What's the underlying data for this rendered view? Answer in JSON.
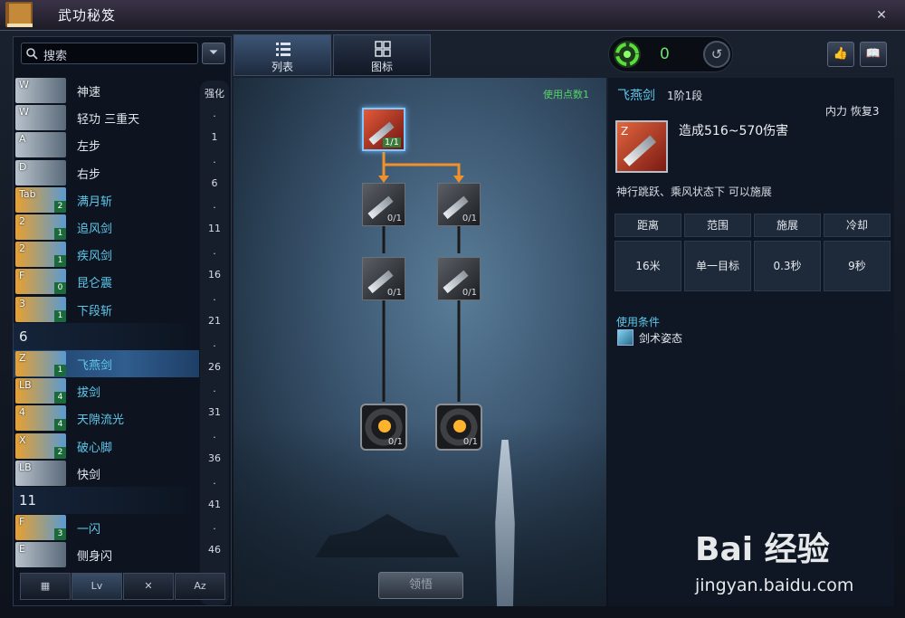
{
  "window": {
    "title": "武功秘笈",
    "close_label": "✕"
  },
  "search": {
    "placeholder": "搜索",
    "filter_icon": "funnel-icon"
  },
  "skill_list": [
    {
      "key": "W",
      "name": "神速",
      "level": "",
      "color": "white"
    },
    {
      "key": "W",
      "name": "轻功 三重天",
      "level": "",
      "color": "white"
    },
    {
      "key": "A",
      "name": "左步",
      "level": "",
      "color": "white"
    },
    {
      "key": "D",
      "name": "右步",
      "level": "",
      "color": "white"
    },
    {
      "key": "Tab",
      "name": "满月斩",
      "level": "2",
      "color": "blue"
    },
    {
      "key": "2",
      "name": "追风剑",
      "level": "1",
      "color": "blue"
    },
    {
      "key": "2",
      "name": "疾风剑",
      "level": "1",
      "color": "blue"
    },
    {
      "key": "F",
      "name": "昆仑震",
      "level": "0",
      "color": "blue"
    },
    {
      "key": "3",
      "name": "下段斩",
      "level": "1",
      "color": "blue"
    },
    {
      "header": "6"
    },
    {
      "key": "Z",
      "name": "飞燕剑",
      "level": "1",
      "color": "blue",
      "selected": true
    },
    {
      "key": "LB",
      "name": "拔剑",
      "level": "4",
      "color": "blue"
    },
    {
      "key": "4",
      "name": "天隙流光",
      "level": "4",
      "color": "blue"
    },
    {
      "key": "X",
      "name": "破心脚",
      "level": "2",
      "color": "blue"
    },
    {
      "key": "LB",
      "name": "快剑",
      "level": "",
      "color": "white"
    },
    {
      "header": "11"
    },
    {
      "key": "F",
      "name": "一闪",
      "level": "3",
      "color": "blue"
    },
    {
      "key": "E",
      "name": "侧身闪",
      "level": "",
      "color": "white"
    }
  ],
  "level_scale": {
    "title": "强化",
    "ticks": [
      "1",
      "6",
      "11",
      "16",
      "21",
      "26",
      "31",
      "36",
      "41",
      "46"
    ]
  },
  "left_tabs": [
    "▦",
    "Lv",
    "✕",
    "Az"
  ],
  "view_tabs": [
    {
      "label": "列表",
      "icon": "list-icon"
    },
    {
      "label": "图标",
      "icon": "grid-icon"
    }
  ],
  "points": {
    "value": "0",
    "icon": "green-swirl-icon",
    "reset_icon": "reset-icon"
  },
  "top_buttons": [
    "👍",
    "📖"
  ],
  "tree": {
    "use_points": "使用点数1",
    "nodes": [
      {
        "count": "1/1",
        "active": true
      },
      {
        "count": "0/1"
      },
      {
        "count": "0/1"
      },
      {
        "count": "0/1"
      },
      {
        "count": "0/1"
      },
      {
        "count": "0/1",
        "gear": true
      },
      {
        "count": "0/1",
        "gear": true
      }
    ],
    "learn_button": "领悟"
  },
  "detail": {
    "name": "飞燕剑",
    "tier": "1阶1段",
    "resource": "内力 恢复3",
    "icon_key": "Z",
    "damage": "造成516~570伤害",
    "desc": "神行跳跃、乘风状态下 可以施展",
    "stats_headers": [
      "距离",
      "范围",
      "施展",
      "冷却"
    ],
    "stats_values": [
      "16米",
      "单一目标",
      "0.3秒",
      "9秒"
    ],
    "condition_title": "使用条件",
    "condition": "剑术姿态"
  },
  "watermark": {
    "brand": "Bai 经验",
    "url": "jingyan.baidu.com"
  }
}
